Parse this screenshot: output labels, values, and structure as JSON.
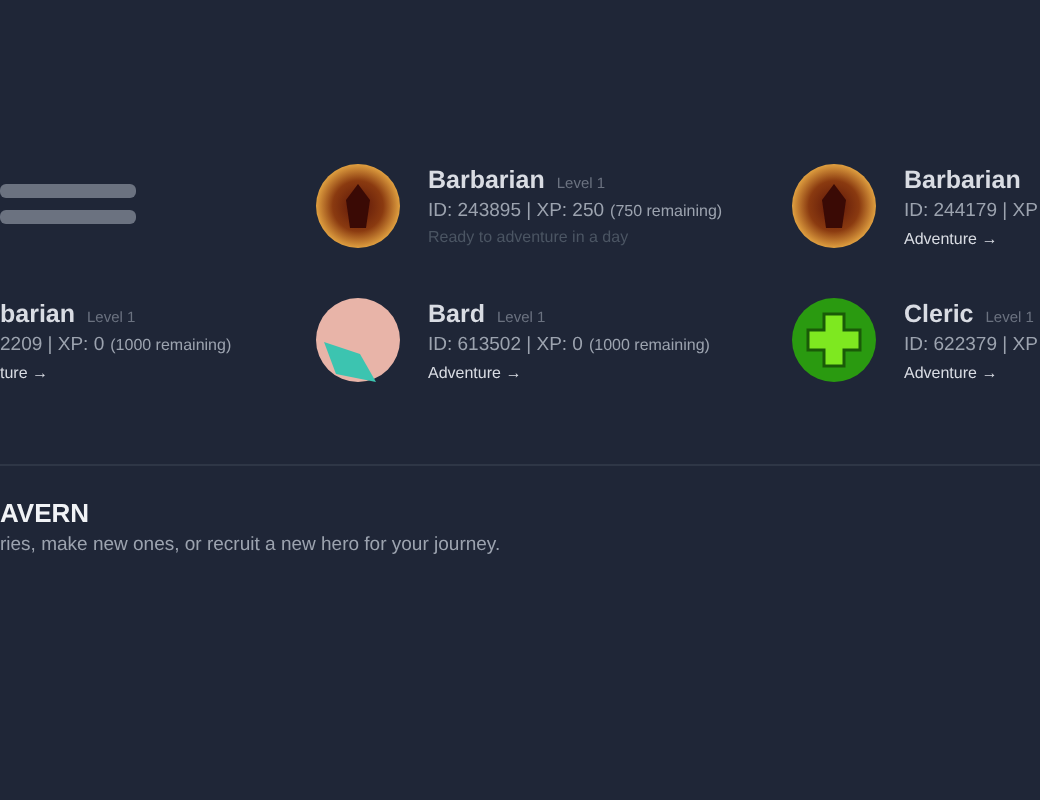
{
  "heroes": [
    {
      "kind": "placeholder"
    },
    {
      "kind": "hero",
      "portrait": {
        "kind": "barbarian"
      },
      "name": "Barbarian",
      "level": "Level 1",
      "stats": "ID: 243895 | XP: 250",
      "remaining": "(750 remaining)",
      "action": {
        "kind": "status",
        "text": "Ready to adventure in a day"
      }
    },
    {
      "kind": "hero",
      "portrait": {
        "kind": "barbarian"
      },
      "name": "Barbarian",
      "stats": "ID: 244179 | XP",
      "action": {
        "kind": "link",
        "text": "Adventure →"
      }
    },
    {
      "kind": "hero",
      "name": "barian",
      "level": "Level 1",
      "stats": "2209 | XP: 0",
      "remaining": "(1000 remaining)",
      "action": {
        "kind": "link",
        "text": "ture →"
      }
    },
    {
      "kind": "hero",
      "portrait": {
        "kind": "bard"
      },
      "name": "Bard",
      "level": "Level 1",
      "stats": "ID: 613502 | XP: 0",
      "remaining": "(1000 remaining)",
      "action": {
        "kind": "link",
        "text": "Adventure →"
      }
    },
    {
      "kind": "hero",
      "portrait": {
        "kind": "cleric"
      },
      "name": "Cleric",
      "level": "Level 1",
      "stats": "ID: 622379 | XP",
      "action": {
        "kind": "link",
        "text": "Adventure →"
      }
    }
  ],
  "section": {
    "title": "AVERN",
    "description": "ries, make new ones, or recruit a new hero for your journey."
  }
}
